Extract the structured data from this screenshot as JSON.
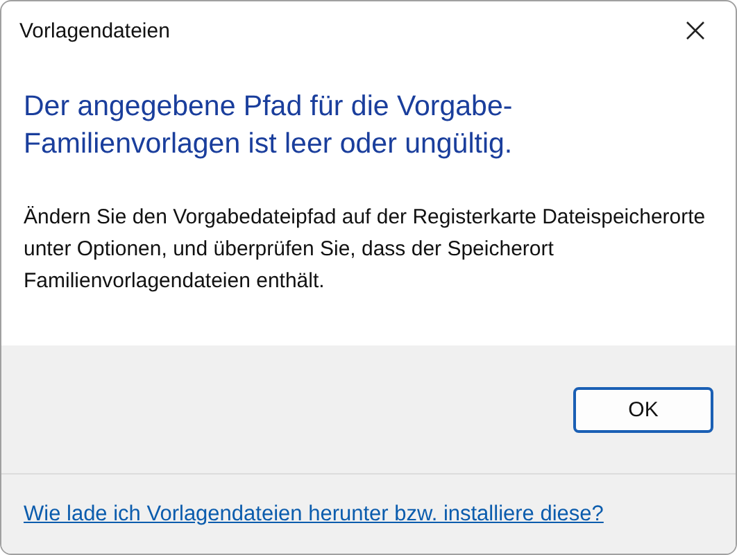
{
  "window": {
    "title": "Vorlagendateien"
  },
  "heading": "Der angegebene Pfad für die Vorgabe-Familienvorlagen ist leer oder ungültig.",
  "message": "Ändern Sie den Vorgabedateipfad auf der Registerkarte Dateispeicherorte unter Optionen, und überprüfen Sie, dass der Speicherort Familienvorlagendateien enthält.",
  "buttons": [
    {
      "label": "OK",
      "kind": "default"
    }
  ],
  "footer_link": "Wie lade ich Vorlagendateien herunter bzw. installiere diese?"
}
